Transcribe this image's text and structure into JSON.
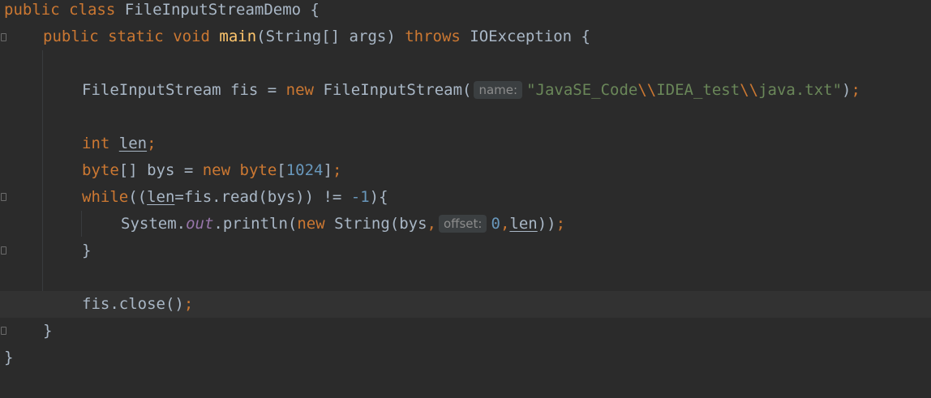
{
  "editor": {
    "line1": {
      "kw1": "public",
      "kw2": "class",
      "text": "FileInputStreamDemo {"
    },
    "line2": {
      "kw1": "public",
      "kw2": "static",
      "kw3": "void",
      "method": "main",
      "params": "(String[] args) ",
      "kw4": "throws",
      "rest": " IOException {"
    },
    "line4": {
      "before": "FileInputStream fis = ",
      "kw": "new",
      "ctor": " FileInputStream(",
      "hint": "name:",
      "str1": "\"JavaSE_Code",
      "esc1": "\\\\",
      "str2": "IDEA_test",
      "esc2": "\\\\",
      "str3": "java.txt\"",
      "close": ")",
      "semi": ";"
    },
    "line6": {
      "kw": "int",
      "var": "len",
      "semi": ";"
    },
    "line7": {
      "kw1": "byte",
      "mid": "[] bys = ",
      "kw2": "new",
      "kw3": "byte",
      "open": "[",
      "num": "1024",
      "close": "]",
      "semi": ";"
    },
    "line8": {
      "kw": "while",
      "p1": "((",
      "var": "len",
      "p2": "=fis.read(bys)) != ",
      "num": "-1",
      "p3": "){"
    },
    "line9": {
      "cls": "System.",
      "field": "out",
      "call": ".println(",
      "kw": "new",
      "ctor": " String(bys",
      "comma1": ",",
      "hint": "offset:",
      "num": "0",
      "comma2": ",",
      "var": "len",
      "close": "))",
      "semi": ";"
    },
    "line10": {
      "text": "}"
    },
    "line12": {
      "text": "fis.close()",
      "semi": ";"
    },
    "line13": {
      "text": "}"
    },
    "line14": {
      "text": "}"
    }
  },
  "colors": {
    "background": "#2b2b2b",
    "keyword": "#cc7832",
    "method": "#ffc66d",
    "string": "#6a8759",
    "number": "#6897bb",
    "static_field": "#9876aa",
    "plain": "#a9b7c6",
    "current_line": "#323232"
  }
}
